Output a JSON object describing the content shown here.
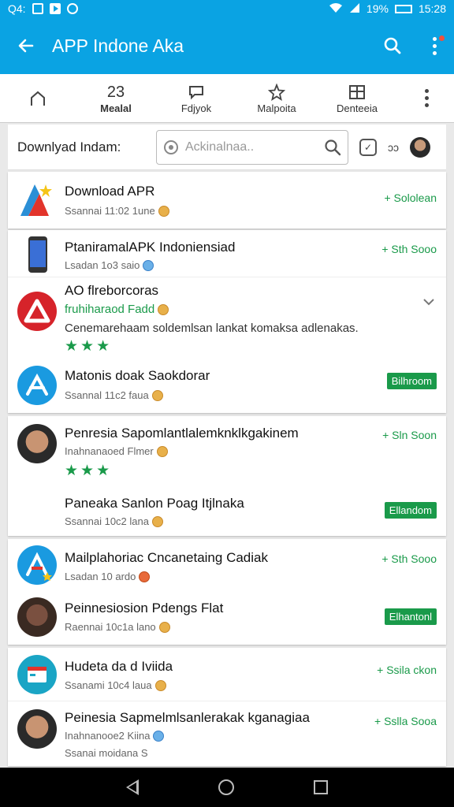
{
  "status_bar": {
    "left_text": "Q4:",
    "signal_pct": "19%",
    "time": "15:28"
  },
  "app_bar": {
    "title": "APP Indone Aka"
  },
  "tabs": [
    {
      "top": "",
      "label": "",
      "icon": "home-icon"
    },
    {
      "top": "23",
      "label": "Mealal",
      "icon": "count"
    },
    {
      "top": "",
      "label": "Fdjyok",
      "icon": "chat-icon"
    },
    {
      "top": "",
      "label": "Malpoita",
      "icon": "star-icon"
    },
    {
      "top": "",
      "label": "Denteeia",
      "icon": "grid-icon"
    }
  ],
  "search": {
    "label": "Downlyad Indam:",
    "placeholder": "Ackinalnaa..",
    "right_text": "ɔɔ"
  },
  "colors": {
    "accent": "#0aa3e3",
    "green": "#1a9a4a"
  },
  "cards": [
    {
      "items": [
        {
          "name": "Download APR",
          "sub": "Ssannai 11:02 1une",
          "action": "+ Sololean",
          "action_type": "link",
          "icon": "red-blue-a-logo"
        }
      ]
    },
    {
      "items": [
        {
          "name": "PtaniramalAPK Indoniensiad",
          "sub": "Lsadan 1o3 saio",
          "action": "+ Sth Sooo",
          "action_type": "link",
          "icon": "phone-icon"
        },
        {
          "name": "AO flreborcoras",
          "sub": "fruhiharaod Fadd",
          "desc": "Cenemarehaam soldemlsan lankat komaksa adlenakas.",
          "stars": "★★★",
          "action": "⌄",
          "action_type": "chevron",
          "icon": "red-a-logo"
        },
        {
          "name": "Matonis doak Saokdorar",
          "sub": "Ssannal 11c2 faua",
          "action": "Bilhroom",
          "action_type": "button",
          "icon": "blue-a-logo"
        }
      ]
    },
    {
      "items": [
        {
          "name": "Penresia Sapomlantlalemknklkgakinem",
          "sub": "Inahnanaoed Flmer",
          "stars": "★★★",
          "action": "+ Sln Soon",
          "action_type": "link",
          "icon": "avatar-icon"
        },
        {
          "name": "Paneaka Sanlon Poag Itjlnaka",
          "sub": "Ssannai 10c2 lana",
          "action": "Ellandom",
          "action_type": "button",
          "icon": ""
        }
      ]
    },
    {
      "items": [
        {
          "name": "Mailplahoriac Cncanetaing Cadiak",
          "sub": "Lsadan 10 ardo",
          "action": "+ Sth Sooo",
          "action_type": "link",
          "icon": "blue-a-logo"
        },
        {
          "name": "Peinnesiosion Pdengs Flat",
          "sub": "Raennai 10c1a lano",
          "action": "Elhantonl",
          "action_type": "button",
          "icon": "avatar-icon"
        }
      ]
    },
    {
      "items": [
        {
          "name": "Hudeta da d Iviida",
          "sub": "Ssanami 10c4 laua",
          "action": "+ Ssila ckon",
          "action_type": "link",
          "icon": "browser-icon"
        },
        {
          "name": "Peinesia Sapmelmlsanlerakak kganagiaa",
          "sub": "Inahnanooe2 Kiina",
          "sub2": "Ssanai moidana S",
          "action": "+ Sslla Sooa",
          "action_type": "link",
          "icon": "avatar-icon"
        }
      ]
    }
  ]
}
